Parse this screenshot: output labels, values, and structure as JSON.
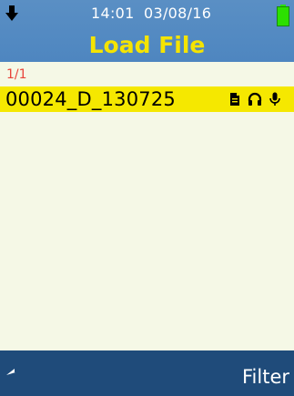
{
  "status_bar": {
    "time": "14:01",
    "date": "03/08/16",
    "left_icon": "download-icon",
    "battery_icon": "battery-icon",
    "battery_color": "#2ce000"
  },
  "header": {
    "title": "Load File",
    "title_color": "#f5e400",
    "background": "#5a8fc4"
  },
  "list": {
    "counter": "1/1",
    "counter_color": "#e8443a",
    "items": [
      {
        "name": "00024_D_130725",
        "selected": true,
        "highlight_color": "#f5e800",
        "icons": [
          "document-icon",
          "headphones-icon",
          "microphone-icon"
        ]
      }
    ]
  },
  "footer": {
    "back_icon": "back-arrow-icon",
    "filter_label": "Filter",
    "background": "#1f4b7a"
  }
}
